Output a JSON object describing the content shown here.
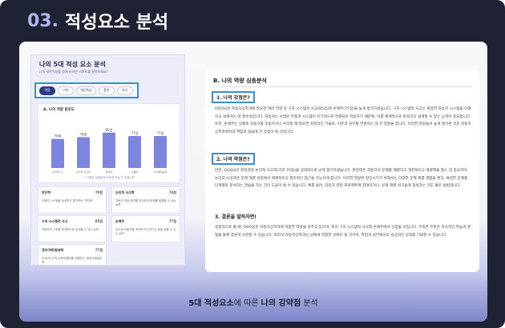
{
  "header": {
    "number": "03.",
    "title": "적성요소 분석"
  },
  "left_card": {
    "title": "나의 5대 적성 요소 분석",
    "subtitle": "나의 대학적성을 함께 분석한 리포트를 살펴보세요!",
    "tabs": [
      {
        "label": "역량",
        "active": true
      },
      {
        "label": "가치",
        "active": false
      },
      {
        "label": "개인특성",
        "active": false
      },
      {
        "label": "흥미",
        "active": false
      },
      {
        "label": "지식",
        "active": false
      }
    ],
    "chart_title": "A. 나의 역량 분포도",
    "chart_note": "*그림은 실제값과 다르게 보일 수 있습니다",
    "chart_data": {
      "type": "bar",
      "categories": [
        "논리적사고",
        "논리적 사고력",
        "분석력",
        "소통력",
        "의사결정능력"
      ],
      "values": [
        70,
        74,
        85,
        77,
        77
      ],
      "ylim": [
        0,
        100
      ],
      "bar_color": "#7e85df"
    },
    "minis": [
      {
        "name": "판단력",
        "score": "70점",
        "desc": "자동차 시스템을 설계하고 평가하는 '판단력'"
      },
      {
        "name": "논리적 사고력",
        "score": "74점",
        "desc": "자동차 작동 원리를 분석하여 문제를 해결할 수 있는 능력"
      },
      {
        "name": "수리·시스템적 사고",
        "score": "85점",
        "desc": "자동차의 구조를 체계적으로 분석할 수 있는 능력"
      },
      {
        "name": "손재주",
        "score": "77점",
        "desc": "손으로 자동차를 조작하거나 만드는 등을 잘할 수 있는 능력"
      },
      {
        "name": "정리이해/발표력",
        "score": "77점",
        "desc": "E/AO의 규칙 소프트웨어를 이해하는 '정리이해발표력'"
      }
    ]
  },
  "right_card": {
    "title": "B. 나의 역량 심층분석",
    "section1": "1. 나의 강점은?",
    "para1": "OOO님은 자동차공학과에 필요한 여러 역량 중 구조·시스템적 사고(85점)와 손재주(77점)을 높게 평가하셨습니다. 구조·시스템적 사고는 복잡한 자동차 시스템을 이해하고 설계하는 데 필수적입니다. 자동차는 수많은 부품과 시스템이 유기적으로 연결되어 작동하기 때문에, 이를 체계적으로 분석하고 설계할 수 있는 능력이 중요합니다. 또한, 손재주는 실제로 자동차를 조립하거나 수리할 때 필요한 실질적인 기술로, 이론과 실무를 연결하는 데 큰 역할을 합니다. 이러한 역량들이 높게 평가된 것은 자동차공학과에서의 학업과 실습에 큰 장점이 될 것입니다.",
    "section2": "2. 나의 약점은?",
    "para2": "반면, OOO님은 판정력과 논리적 사고력(각각 70점)을 상대적으로 낮게 평가하셨습니다. 판정력은 자동차의 문제를 해결하고 객관적이고 해결책을 찾는 데 중요하며, 논리적 사고력은 문제 해결 과정에서 체계적이고 합리적인 접근을 가능하게 합니다. 이러한 역량은 향상시키기 위해서는 다양한 문제 해결 경험을 쌓고, 복잡한 문제를 단계별로 분석하는 연습을 하는 것이 도움이 될 수 있습니다. 예를 들어, 자동차 관련 프로젝트에 참여하거나, 문제 해결 워크숍에 참석하는 것도 좋은 방법입니다.",
    "section3": "3. 결론을 말하자면!",
    "para3": "종합적으로 볼 때, OOO님은 자동차공학과에 적합한 역량을 갖추고 있으며, 특히 구조·시스템적 사고와 손재주에서 강점을 보입니다. 부족한 부분은 지속적인 학습과 경험을 통해 충분히 보완할 수 있습니다. 따라서 자동차공학과는 님에게 적합한 선택이 될 것이며, 학업과 실무에서의 성공적인 성과를 기대할 수 있습니다."
  },
  "caption": {
    "part1": "5대 적성요소",
    "part2": "에 따른 ",
    "part3": "나의 강약점",
    "part4": " 분석"
  }
}
